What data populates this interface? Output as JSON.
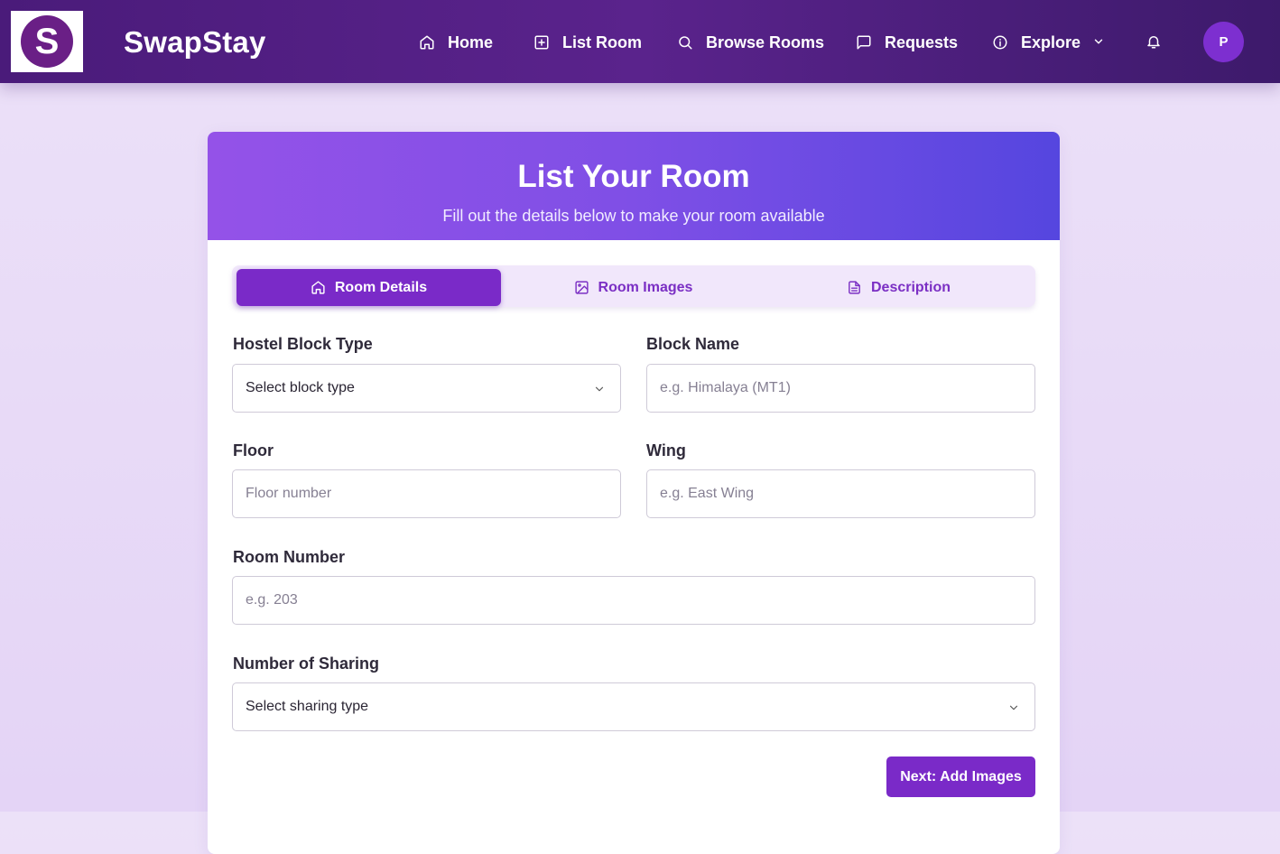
{
  "app": {
    "logo_letter": "S",
    "brand": "SwapStay"
  },
  "nav": {
    "items": [
      {
        "label": "Home",
        "icon": "home-icon"
      },
      {
        "label": "List Room",
        "icon": "plus-square-icon"
      },
      {
        "label": "Browse Rooms",
        "icon": "search-icon"
      },
      {
        "label": "Requests",
        "icon": "chat-icon"
      },
      {
        "label": "Explore",
        "icon": "info-icon"
      }
    ],
    "avatar_initial": "P"
  },
  "form": {
    "title": "List Your Room",
    "subtitle": "Fill out the details below to make your room available",
    "tabs": [
      {
        "label": "Room Details",
        "icon": "home-icon",
        "active": true
      },
      {
        "label": "Room Images",
        "icon": "image-icon",
        "active": false
      },
      {
        "label": "Description",
        "icon": "document-icon",
        "active": false
      }
    ],
    "fields": {
      "block_type": {
        "label": "Hostel Block Type",
        "value": "Select block type"
      },
      "block_name": {
        "label": "Block Name",
        "placeholder": "e.g. Himalaya (MT1)"
      },
      "floor": {
        "label": "Floor",
        "placeholder": "Floor number"
      },
      "wing": {
        "label": "Wing",
        "placeholder": "e.g. East Wing"
      },
      "room_number": {
        "label": "Room Number",
        "placeholder": "e.g. 203"
      },
      "sharing": {
        "label": "Number of Sharing",
        "value": "Select sharing type"
      }
    },
    "next_button": "Next: Add Images"
  },
  "colors": {
    "nav_bg": "#4a1b7a",
    "accent": "#7a2ac8",
    "header_gradient_start": "#9452e8",
    "header_gradient_end": "#5546df",
    "page_bg": "#e8dbf7"
  }
}
